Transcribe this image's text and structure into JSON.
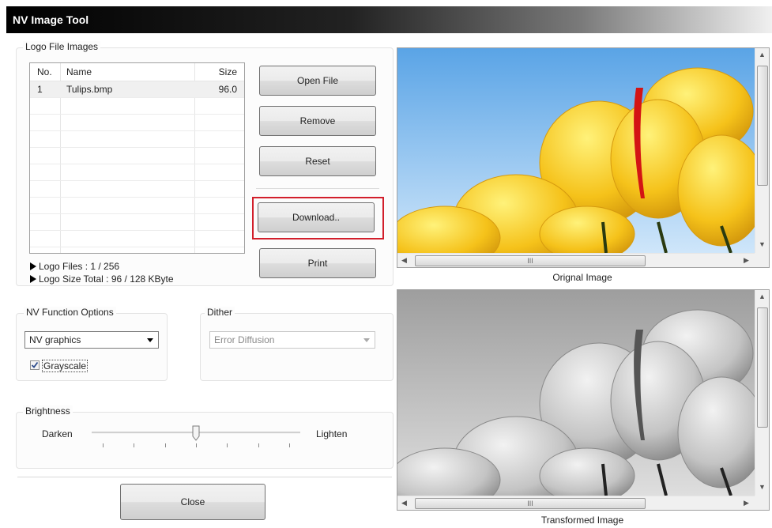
{
  "window": {
    "title": "NV Image Tool"
  },
  "logo_group": {
    "label": "Logo File Images",
    "columns": [
      "No.",
      "Name",
      "Size"
    ],
    "rows": [
      {
        "no": "1",
        "name": "Tulips.bmp",
        "size": "96.0"
      }
    ],
    "info": {
      "files": "Logo Files : 1 / 256",
      "size_total": "Logo Size Total : 96 / 128 KByte"
    }
  },
  "buttons": {
    "open_file": "Open File",
    "remove": "Remove",
    "reset": "Reset",
    "download": "Download..",
    "print": "Print",
    "close": "Close"
  },
  "nv_function": {
    "label": "NV Function Options",
    "selected": "NV graphics",
    "grayscale_label": "Grayscale",
    "grayscale_checked": true
  },
  "dither": {
    "label": "Dither",
    "selected": "Error Diffusion",
    "enabled": false
  },
  "brightness": {
    "label": "Brightness",
    "min_label": "Darken",
    "max_label": "Lighten",
    "value_fraction": 0.5
  },
  "images": {
    "original_caption": "Orignal Image",
    "transformed_caption": "Transformed Image",
    "scroll_grip": "III"
  },
  "colors": {
    "highlight": "#d21f2b"
  }
}
